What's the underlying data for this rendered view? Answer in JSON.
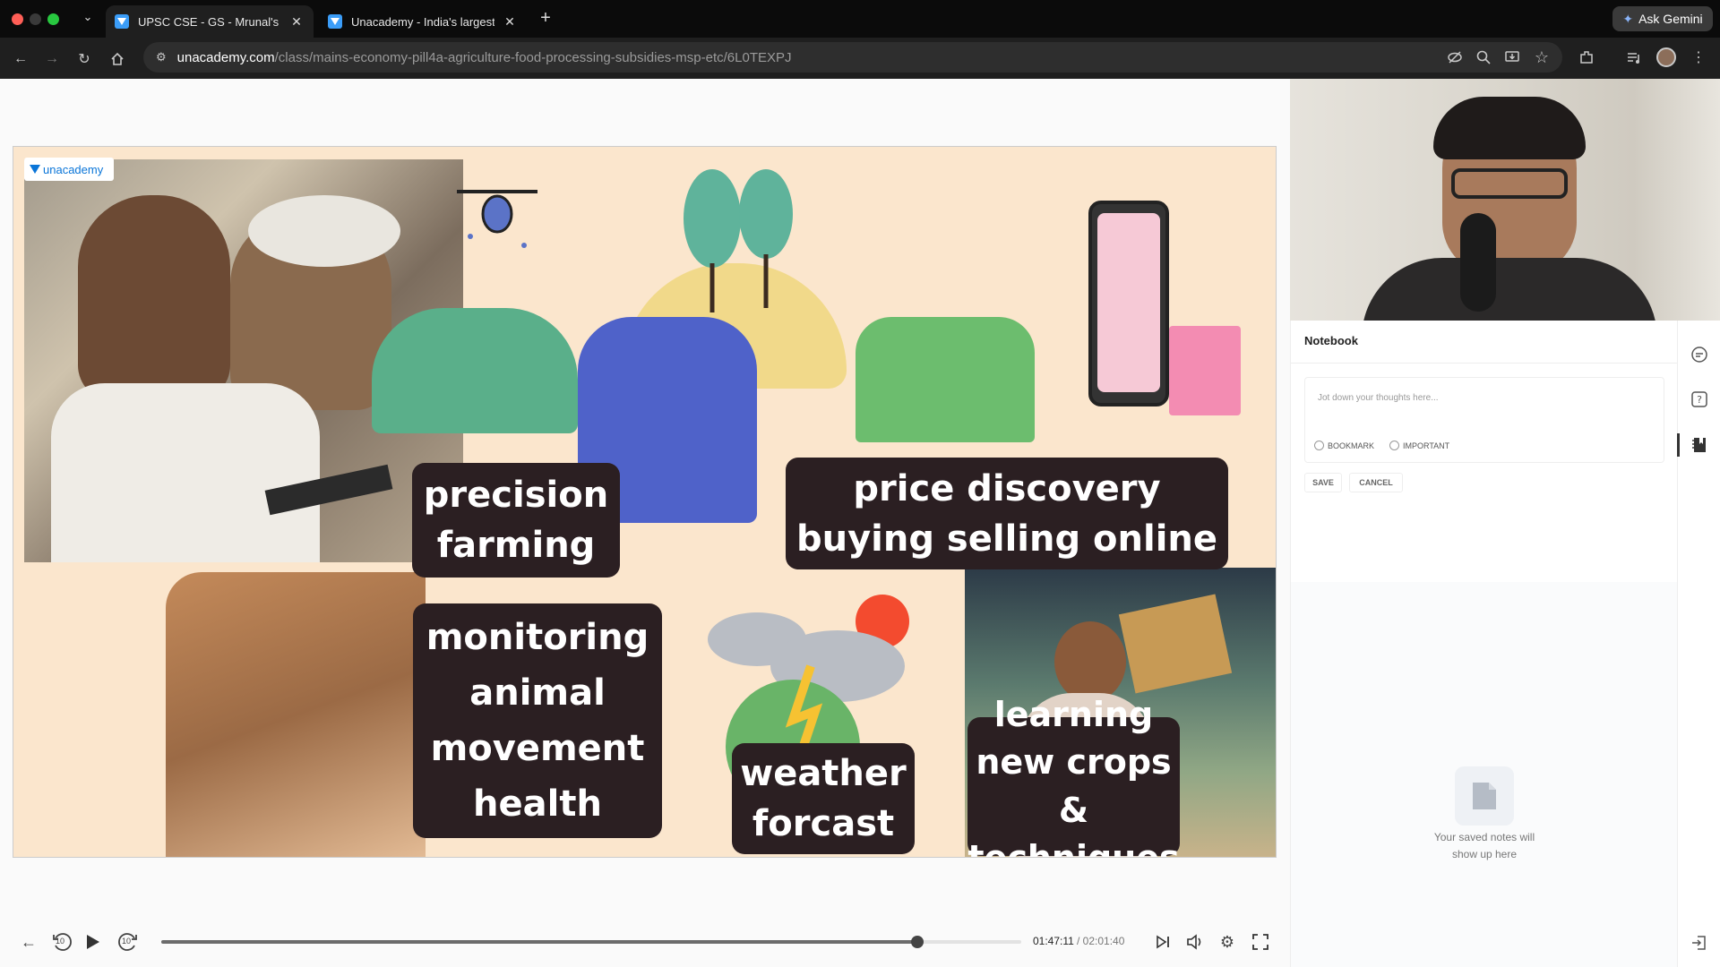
{
  "browser": {
    "tabs": [
      {
        "title": "UPSC CSE - GS - Mrunal's Ec",
        "active": true
      },
      {
        "title": "Unacademy - India's largest l",
        "active": false
      }
    ],
    "ask_gemini": "Ask Gemini",
    "url_host": "unacademy.com",
    "url_path": "/class/mains-economy-pill4a-agriculture-food-processing-subsidies-msp-etc/6L0TEXPJ"
  },
  "slide": {
    "brand": "unacademy",
    "labels": {
      "precision_1": "precision",
      "precision_2": "farming",
      "price_1": "price discovery",
      "price_2": "buying selling online",
      "monitor_1": "monitoring",
      "monitor_2": "animal",
      "monitor_3": "movement",
      "monitor_4": "health",
      "weather_1": "weather",
      "weather_2": "forcast",
      "learn_1": "learning",
      "learn_2": "new crops &",
      "learn_3": "techniques"
    }
  },
  "player": {
    "current_time": "01:47:11",
    "total_time": "/ 02:01:40",
    "progress": 0.879,
    "skip_seconds": "10"
  },
  "notebook": {
    "title": "Notebook",
    "placeholder": "Jot down your thoughts here...",
    "bookmark_label": "BOOKMARK",
    "important_label": "IMPORTANT",
    "save_label": "SAVE",
    "cancel_label": "CANCEL",
    "empty_1": "Your saved notes will",
    "empty_2": "show up here"
  },
  "colors": {
    "label_bg": "#2b1f22",
    "slide_bg": "#fbe6cd",
    "progress_fill": "#6b6b6b"
  }
}
